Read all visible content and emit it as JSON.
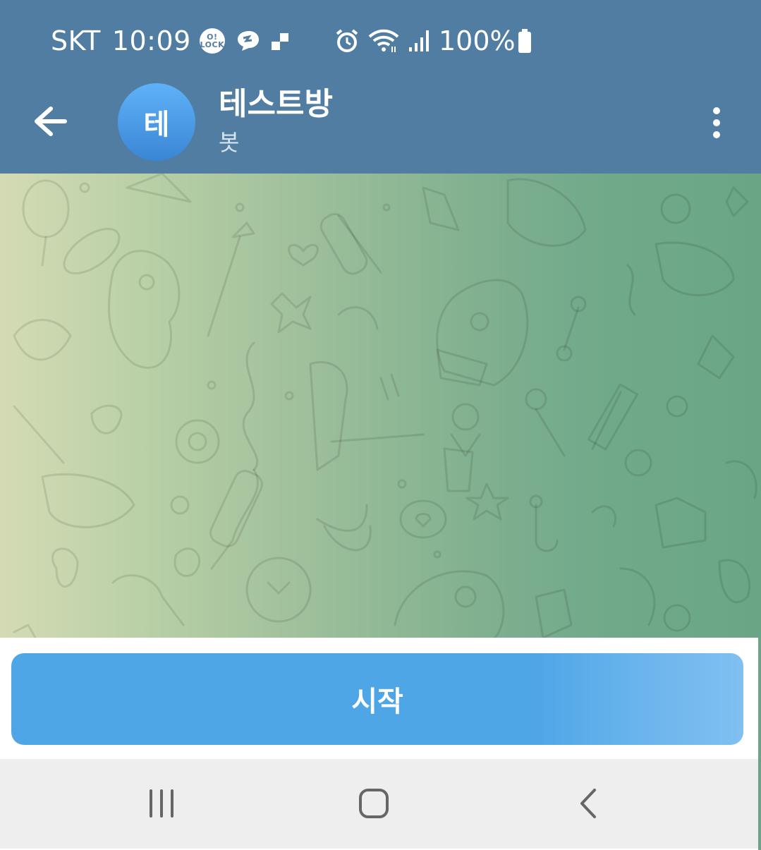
{
  "status_bar": {
    "carrier": "SKT",
    "time": "10:09",
    "olock_badge": "O!\nLOCK",
    "battery": "100%",
    "icons": [
      "olock-icon",
      "bubble-icon",
      "data-icon",
      "alarm-icon",
      "wifi-icon",
      "signal-icon",
      "battery-icon"
    ]
  },
  "header": {
    "avatar_letter": "테",
    "title": "테스트방",
    "subtitle": "봇",
    "icons": [
      "back-arrow-icon",
      "more-vertical-icon"
    ]
  },
  "bottom": {
    "start_label": "시작"
  },
  "navbar": {
    "icons": [
      "recents-icon",
      "home-icon",
      "back-icon"
    ]
  },
  "colors": {
    "header_bg": "#517da2",
    "avatar_gradient_top": "#5fb2f7",
    "avatar_gradient_bottom": "#3a86d6",
    "start_button": "#4fa6e7",
    "chat_bg_left": "#d4dbb4",
    "chat_bg_right": "#6aa686",
    "navbar_bg": "#eeeeee"
  }
}
